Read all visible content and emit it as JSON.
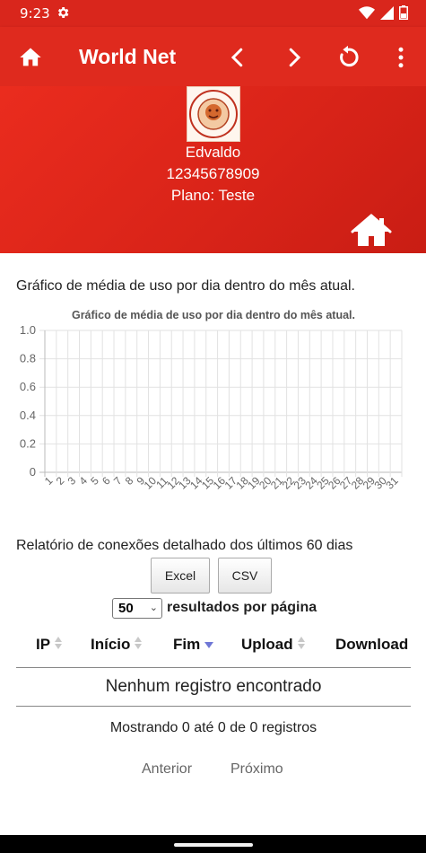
{
  "status_bar": {
    "time": "9:23"
  },
  "app_bar": {
    "title": "World Net"
  },
  "profile": {
    "name": "Edvaldo",
    "phone": "12345678909",
    "plan": "Plano: Teste"
  },
  "usage": {
    "caption": "Gráfico de média de uso por dia dentro do mês atual.",
    "chart_data": {
      "type": "line",
      "title": "Gráfico de média de uso por dia dentro do mês atual.",
      "categories": [
        "1",
        "2",
        "3",
        "4",
        "5",
        "6",
        "7",
        "8",
        "9",
        "10",
        "11",
        "12",
        "13",
        "14",
        "15",
        "16",
        "17",
        "18",
        "19",
        "20",
        "21",
        "22",
        "23",
        "24",
        "25",
        "26",
        "27",
        "28",
        "29",
        "30",
        "31"
      ],
      "series": [],
      "y_ticks": [
        "0",
        "0.2",
        "0.4",
        "0.6",
        "0.8",
        "1.0"
      ],
      "ylim": [
        0,
        1.0
      ],
      "grid": true,
      "legend": "none"
    }
  },
  "report": {
    "title": "Relatório de conexões detalhado dos últimos 60 dias",
    "excel_label": "Excel",
    "csv_label": "CSV",
    "page_size_value": "50",
    "page_size_label": "resultados por página",
    "columns": [
      "IP",
      "Início",
      "Fim",
      "Upload",
      "Download"
    ],
    "empty_message": "Nenhum registro encontrado",
    "info": "Mostrando 0 até 0 de 0 registros",
    "prev_label": "Anterior",
    "next_label": "Próximo"
  },
  "colors": {
    "brand_red": "#df2a1e",
    "sort_active": "#6f77d6",
    "sort_inactive": "#c8c8c8"
  },
  "icons": [
    "gear-icon",
    "wifi-icon",
    "signal-icon",
    "battery-icon",
    "home-icon",
    "chevron-left-icon",
    "chevron-right-icon",
    "refresh-icon",
    "more-vert-icon",
    "logo"
  ]
}
